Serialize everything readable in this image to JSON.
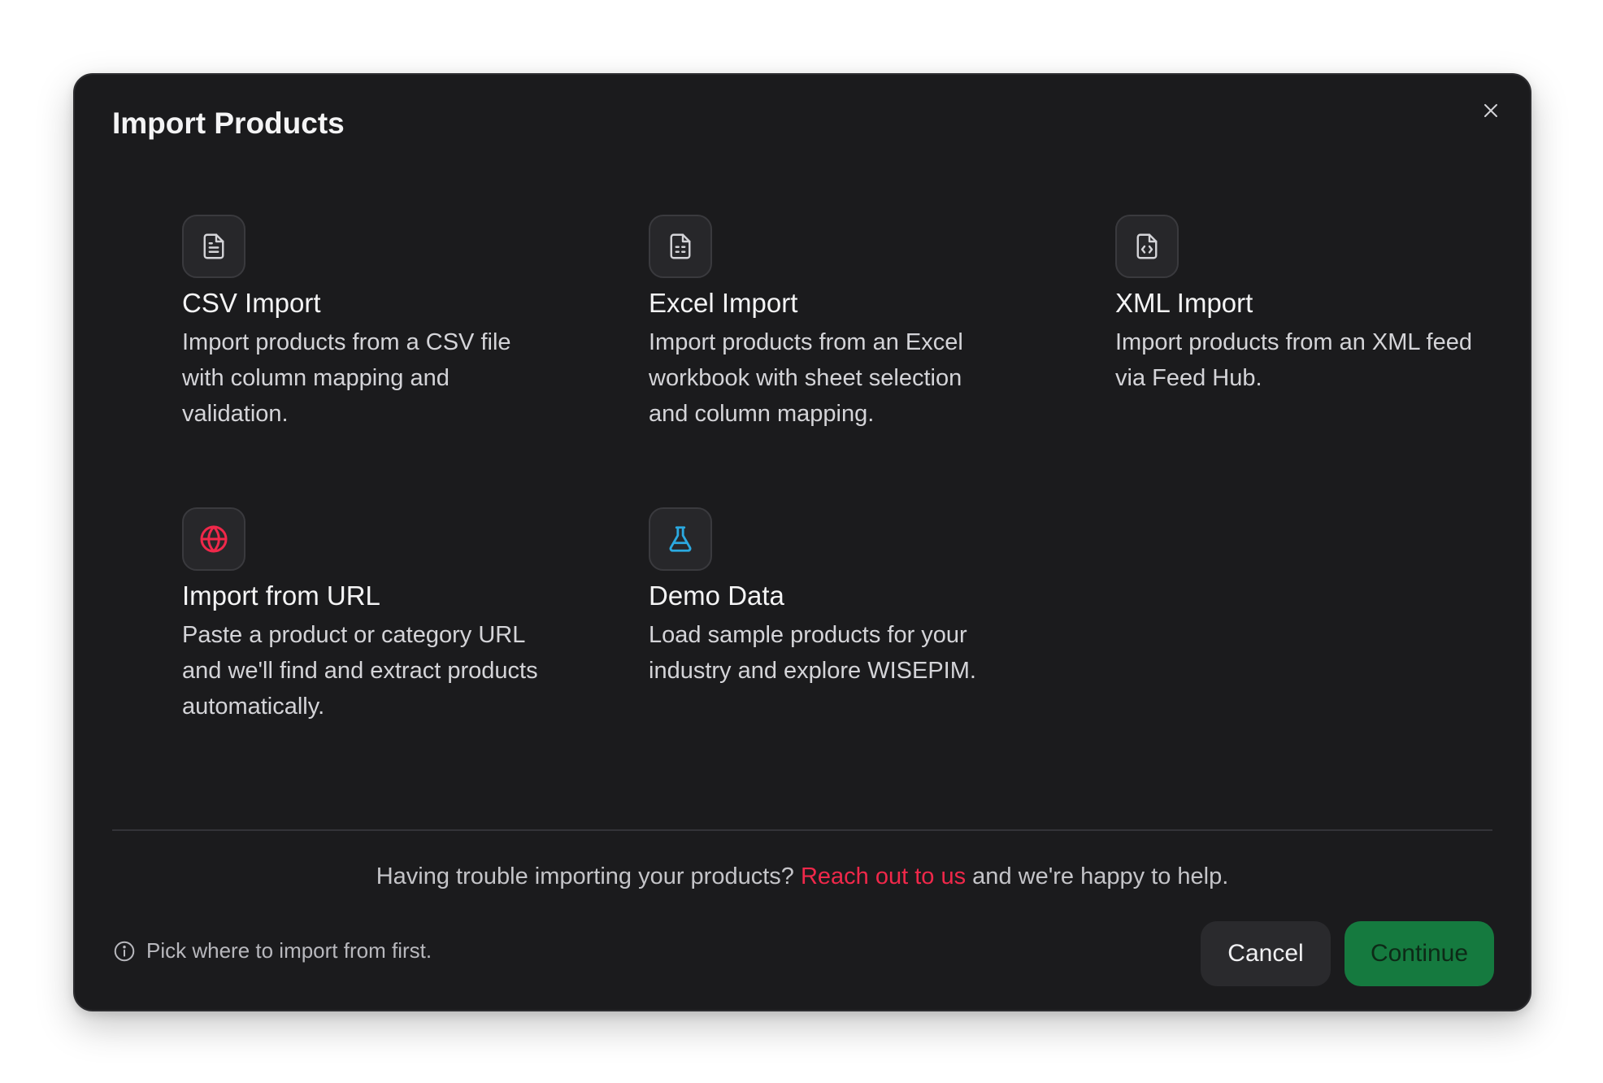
{
  "modal": {
    "title": "Import Products",
    "close_icon": "close-icon"
  },
  "options": [
    {
      "title": "CSV Import",
      "description": "Import products from a CSV file with column mapping and validation.",
      "icon": "file-text-icon",
      "icon_color": "#d4d4d8"
    },
    {
      "title": "Excel Import",
      "description": "Import products from an Excel workbook with sheet selection and column mapping.",
      "icon": "file-spreadsheet-icon",
      "icon_color": "#d4d4d8"
    },
    {
      "title": "XML Import",
      "description": "Import products from an XML feed via Feed Hub.",
      "icon": "file-code-icon",
      "icon_color": "#d4d4d8"
    },
    {
      "title": "Import from URL",
      "description": "Paste a product or category URL and we'll find and extract products automatically.",
      "icon": "globe-icon",
      "icon_color": "#f0284a"
    },
    {
      "title": "Demo Data",
      "description": "Load sample products for your industry and explore WISEPIM.",
      "icon": "flask-icon",
      "icon_color": "#2ba9e0"
    }
  ],
  "footer": {
    "help_prefix": "Having trouble importing your products? ",
    "help_link": "Reach out to us",
    "help_suffix": " and we're happy to help.",
    "hint": "Pick where to import from first.",
    "hint_icon": "info-icon",
    "cancel_label": "Cancel",
    "continue_label": "Continue"
  },
  "colors": {
    "modal_background": "#1b1b1d",
    "accent_link": "#f0284a",
    "continue_button": "#157a3f"
  }
}
